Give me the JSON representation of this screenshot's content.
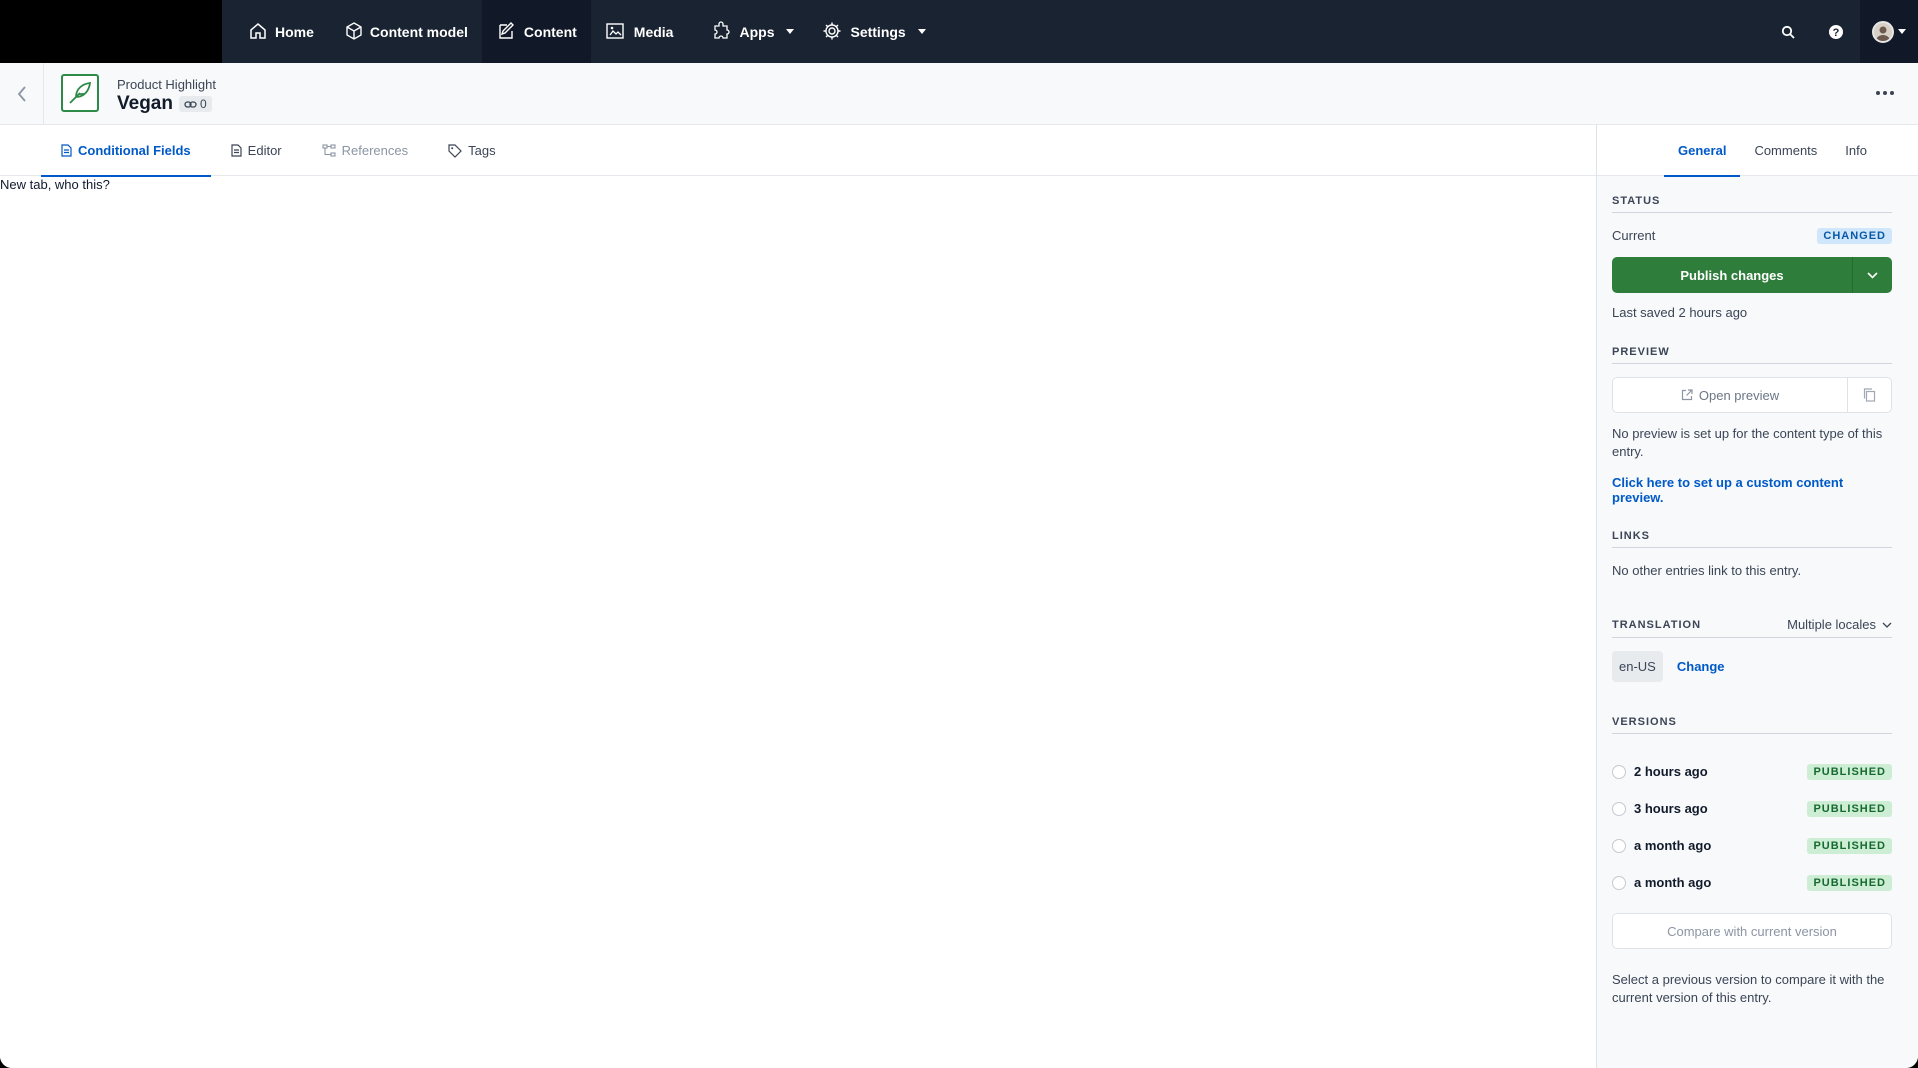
{
  "nav": {
    "items": [
      {
        "label": "Home",
        "icon": "home-icon"
      },
      {
        "label": "Content model",
        "icon": "content-model-icon"
      },
      {
        "label": "Content",
        "icon": "content-icon"
      },
      {
        "label": "Media",
        "icon": "media-icon"
      },
      {
        "label": "Apps",
        "icon": "apps-icon"
      },
      {
        "label": "Settings",
        "icon": "settings-icon"
      }
    ]
  },
  "entry": {
    "content_type": "Product Highlight",
    "title": "Vegan",
    "link_count": "0"
  },
  "tabs": [
    {
      "label": "Conditional Fields"
    },
    {
      "label": "Editor"
    },
    {
      "label": "References"
    },
    {
      "label": "Tags"
    }
  ],
  "tab_body": "New tab, who this?",
  "sidebar": {
    "tabs": [
      "General",
      "Comments",
      "Info"
    ],
    "status": {
      "heading": "STATUS",
      "current_label": "Current",
      "badge": "CHANGED",
      "publish_label": "Publish changes",
      "last_saved": "Last saved 2 hours ago"
    },
    "preview": {
      "heading": "PREVIEW",
      "open_label": "Open preview",
      "note": "No preview is set up for the content type of this entry.",
      "setup_link": "Click here to set up a custom content preview."
    },
    "links": {
      "heading": "LINKS",
      "note": "No other entries link to this entry."
    },
    "translation": {
      "heading": "TRANSLATION",
      "mode": "Multiple locales",
      "locale": "en-US",
      "change_label": "Change"
    },
    "versions": {
      "heading": "VERSIONS",
      "items": [
        {
          "label": "2 hours ago",
          "status": "PUBLISHED"
        },
        {
          "label": "3 hours ago",
          "status": "PUBLISHED"
        },
        {
          "label": "a month ago",
          "status": "PUBLISHED"
        },
        {
          "label": "a month ago",
          "status": "PUBLISHED"
        }
      ],
      "compare_label": "Compare with current version",
      "note": "Select a previous version to compare it with the current version of this entry."
    }
  },
  "colors": {
    "nav_bg": "#1a2332",
    "accent": "#0059c8",
    "publish": "#2e7d3a"
  }
}
